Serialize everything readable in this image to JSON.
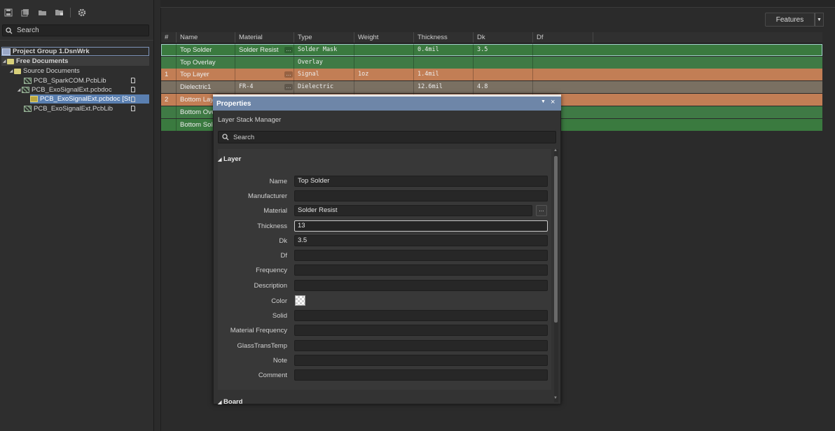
{
  "left_panel": {
    "search_label": "Search",
    "tree": [
      {
        "label": "Project Group 1.DsnWrk",
        "icon": "project-icon"
      },
      {
        "label": "Free Documents",
        "icon": "folder-icon"
      },
      {
        "label": "Source Documents",
        "icon": "folder-icon"
      },
      {
        "label": "PCB_SparkCOM.PcbLib",
        "icon": "pcb-library-icon"
      },
      {
        "label": "PCB_ExoSignalExt.pcbdoc",
        "icon": "pcb-document-icon"
      },
      {
        "label": "PCB_ExoSignalExt.pcbdoc [St",
        "icon": "pcb-document-icon"
      },
      {
        "label": "PCB_ExoSignalExt.PcbLib",
        "icon": "pcb-library-icon"
      }
    ]
  },
  "features": {
    "label": "Features"
  },
  "table": {
    "headers": [
      "#",
      "Name",
      "Material",
      "Type",
      "Weight",
      "Thickness",
      "Dk",
      "Df"
    ],
    "rows": [
      {
        "num": "",
        "name": "Top Solder",
        "material": "Solder Resist",
        "type": "Solder Mask",
        "weight": "",
        "thickness": "0.4mil",
        "dk": "3.5",
        "df": "",
        "color": "#3a7a3f"
      },
      {
        "num": "",
        "name": "Top Overlay",
        "material": "",
        "type": "Overlay",
        "weight": "",
        "thickness": "",
        "dk": "",
        "df": "",
        "color": "#3f7a45"
      },
      {
        "num": "1",
        "name": "Top Layer",
        "material": "",
        "type": "Signal",
        "weight": "1oz",
        "thickness": "1.4mil",
        "dk": "",
        "df": "",
        "color": "#c27e55"
      },
      {
        "num": "",
        "name": "Dielectric1",
        "material": "FR-4",
        "type": "Dielectric",
        "weight": "",
        "thickness": "12.6mil",
        "dk": "4.8",
        "df": "",
        "color": "#7a7062"
      },
      {
        "num": "2",
        "name": "Bottom Layer",
        "material": "",
        "type": "",
        "weight": "",
        "thickness": "",
        "dk": "",
        "df": "",
        "color": "#c27e55"
      },
      {
        "num": "",
        "name": "Bottom Overlay",
        "material": "",
        "type": "",
        "weight": "",
        "thickness": "",
        "dk": "",
        "df": "",
        "color": "#3f7a45"
      },
      {
        "num": "",
        "name": "Bottom Solder",
        "material": "",
        "type": "",
        "weight": "",
        "thickness": "",
        "dk": "",
        "df": "",
        "color": "#3a7a3f"
      }
    ]
  },
  "properties": {
    "title": "Properties",
    "subtitle": "Layer Stack Manager",
    "search_label": "Search",
    "section_layer": "Layer",
    "section_board": "Board",
    "fields": {
      "name": {
        "label": "Name",
        "value": "Top Solder"
      },
      "manufacturer": {
        "label": "Manufacturer",
        "value": ""
      },
      "material": {
        "label": "Material",
        "value": "Solder Resist"
      },
      "thickness": {
        "label": "Thickness",
        "value": "13"
      },
      "dk": {
        "label": "Dk",
        "value": "3.5"
      },
      "df": {
        "label": "Df",
        "value": ""
      },
      "frequency": {
        "label": "Frequency",
        "value": ""
      },
      "description": {
        "label": "Description",
        "value": ""
      },
      "color": {
        "label": "Color"
      },
      "solid": {
        "label": "Solid",
        "value": ""
      },
      "material_frequency": {
        "label": "Material Frequency",
        "value": ""
      },
      "glass_trans_temp": {
        "label": "GlassTransTemp",
        "value": ""
      },
      "note": {
        "label": "Note",
        "value": ""
      },
      "comment": {
        "label": "Comment",
        "value": ""
      }
    }
  }
}
